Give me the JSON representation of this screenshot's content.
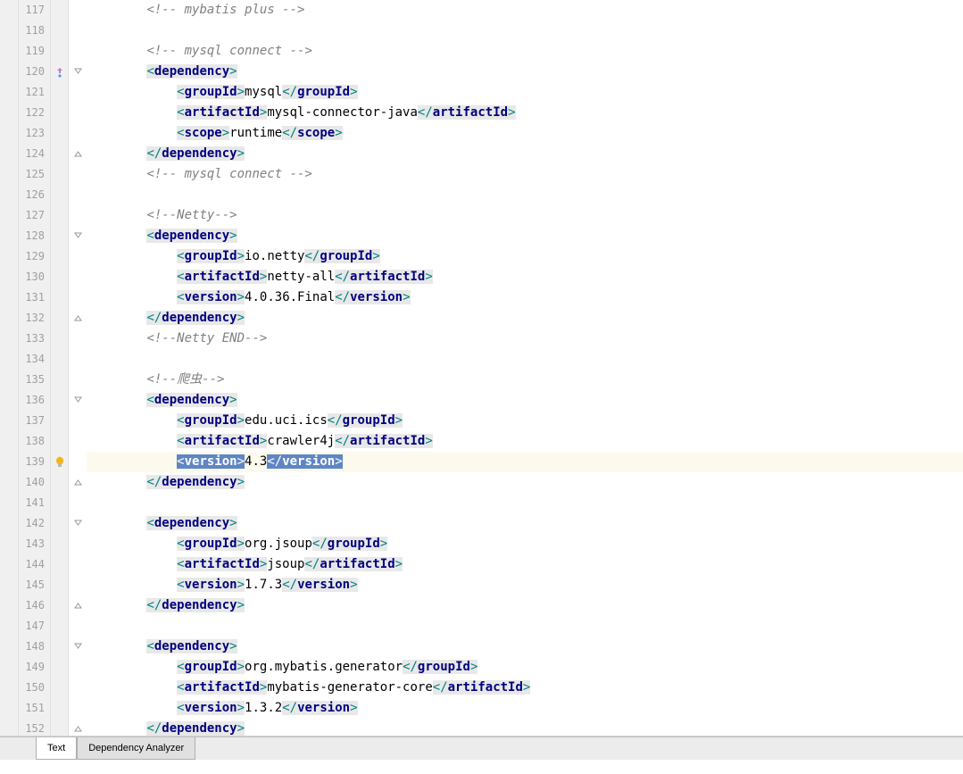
{
  "lineStart": 117,
  "highlightedLine": 139,
  "tabs": {
    "text": "Text",
    "depAnalyzer": "Dependency Analyzer"
  },
  "comments": {
    "mybatis_plus": "<!-- mybatis plus -->",
    "mysql_connect_open": "<!-- mysql connect -->",
    "mysql_connect_close": "<!-- mysql connect -->",
    "netty_open": "<!--Netty-->",
    "netty_close": "<!--Netty END-->",
    "crawler_open": "<!--爬虫-->"
  },
  "tags": {
    "dependency": "dependency",
    "groupId": "groupId",
    "artifactId": "artifactId",
    "version": "version",
    "scope": "scope"
  },
  "deps": {
    "mysql": {
      "groupId": "mysql",
      "artifactId": "mysql-connector-java",
      "scope": "runtime"
    },
    "netty": {
      "groupId": "io.netty",
      "artifactId": "netty-all",
      "version": "4.0.36.Final"
    },
    "crawler": {
      "groupId": "edu.uci.ics",
      "artifactId": "crawler4j",
      "version": "4.3"
    },
    "jsoup": {
      "groupId": "org.jsoup",
      "artifactId": "jsoup",
      "version": "1.7.3"
    },
    "mbg": {
      "groupId": "org.mybatis.generator",
      "artifactId": "mybatis-generator-core",
      "version": "1.3.2"
    }
  }
}
